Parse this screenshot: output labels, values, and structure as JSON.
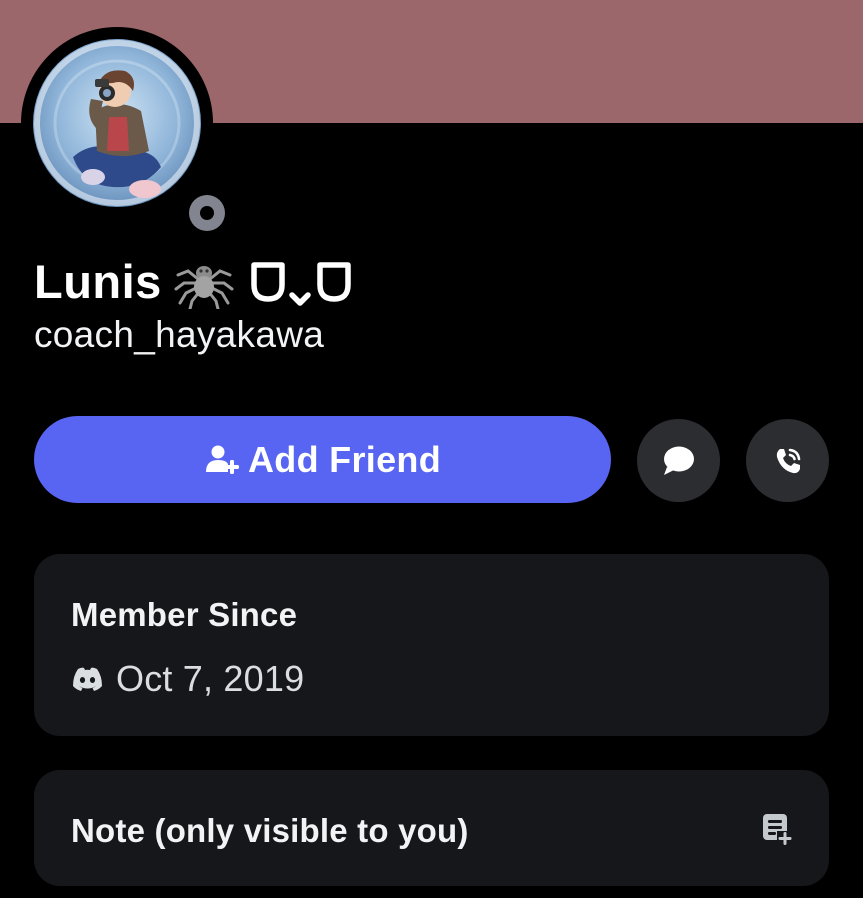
{
  "profile": {
    "display_name": "Lunis",
    "username": "coach_hayakawa",
    "status": "offline",
    "banner_color": "#9b676b",
    "name_decorations": [
      "spider-icon",
      "kaomoji-icon"
    ]
  },
  "actions": {
    "add_friend_label": "Add Friend",
    "add_friend_color": "#5865f2",
    "message_icon": "chat-bubble-icon",
    "call_icon": "phone-call-icon"
  },
  "member_since": {
    "title": "Member Since",
    "date": "Oct 7, 2019",
    "icon": "discord-logo-icon"
  },
  "note": {
    "title": "Note (only visible to you)",
    "icon": "edit-note-icon"
  }
}
